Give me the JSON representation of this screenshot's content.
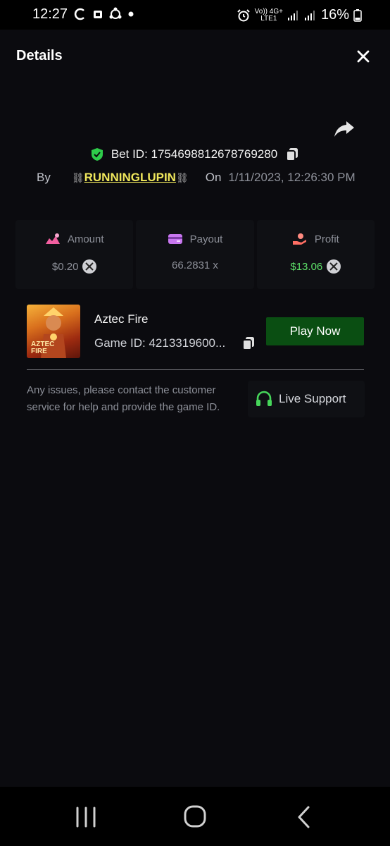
{
  "status_bar": {
    "time": "12:27",
    "network_top": "Vo)) 4G+",
    "network_bottom": "LTE1",
    "battery": "16%"
  },
  "header": {
    "title": "Details"
  },
  "bet": {
    "id_label": "Bet ID: 1754698812678769280",
    "by_label": "By",
    "username": "RUNNINGLUPIN",
    "chain_left": "⛓",
    "chain_right": "⛓",
    "on_label": "On",
    "datetime": "1/11/2023, 12:26:30 PM"
  },
  "stats": {
    "amount_label": "Amount",
    "amount_value": "$0.20",
    "payout_label": "Payout",
    "payout_value": "66.2831 x",
    "profit_label": "Profit",
    "profit_value": "$13.06"
  },
  "game": {
    "name": "Aztec Fire",
    "id_label": "Game ID: 4213319600...",
    "thumb_text_1": "AZTEC",
    "thumb_text_2": "FIRE",
    "play_label": "Play Now"
  },
  "support": {
    "message": "Any issues, please contact the customer service for help and provide the game ID.",
    "button_label": "Live Support"
  },
  "colors": {
    "background": "#0b0b0f",
    "username": "#f0e75c",
    "profit": "#5ee16a",
    "play_button": "#0a4e12",
    "support_icon": "#46d65a"
  }
}
